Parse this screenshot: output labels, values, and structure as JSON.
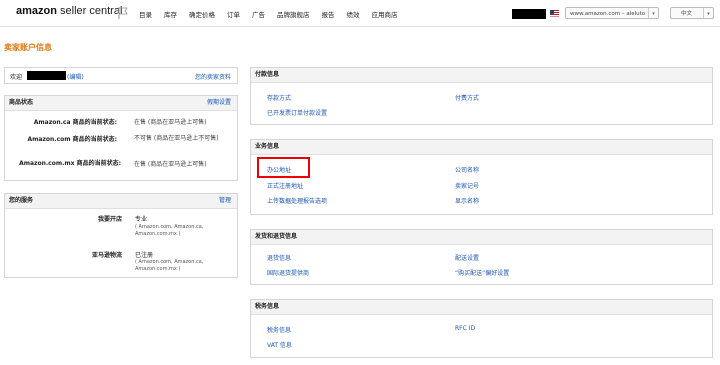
{
  "header": {
    "logo_brand": "amazon",
    "logo_product": " seller central",
    "nav": [
      "目录",
      "库存",
      "确定价格",
      "订单",
      "广告",
      "品牌旗舰店",
      "报告",
      "绩效",
      "应用商店"
    ],
    "marketplace_select": "www.amazon.com – aleluto",
    "language_select": "中文",
    "accent_color": "#e47911"
  },
  "page_title": "卖家账户信息",
  "welcome": {
    "prefix": "欢迎",
    "edit_link": "(编辑)",
    "seller_profile_link": "您的卖家资料"
  },
  "listing_status": {
    "title": "商品状态",
    "action": "假期设置",
    "rows": [
      {
        "label": "Amazon.ca 商品的当前状态:",
        "value": "在售 (商品在亚马逊上可售)"
      },
      {
        "label": "Amazon.com 商品的当前状态:",
        "value": "不可售 (商品在亚马逊上不可售)"
      },
      {
        "label": "Amazon.com.mx 商品的当前状态:",
        "value": "在售 (商品在亚马逊上可售)"
      }
    ]
  },
  "your_services": {
    "title": "您的服务",
    "action": "管理",
    "rows": [
      {
        "label": "我要开店",
        "value": "专业",
        "detail": "( Amazon.com, Amazon.ca, Amazon.com.mx )"
      },
      {
        "label": "亚马逊物流",
        "value": "已注册",
        "detail": "( Amazon.com, Amazon.ca, Amazon.com.mx )"
      }
    ]
  },
  "payment_info": {
    "title": "付款信息",
    "links": [
      "存款方式",
      "付费方式",
      "已开发票订单付款设置"
    ]
  },
  "business_info": {
    "title": "业务信息",
    "links": [
      "办公地址",
      "公司名称",
      "正式注册地址",
      "卖家记号",
      "上传数据处理报告选项",
      "显示名称"
    ]
  },
  "shipping_returns": {
    "title": "发货和退货信息",
    "links": [
      "退货信息",
      "配送设置",
      "国际退货提供商",
      "“购买配送”偏好设置"
    ]
  },
  "tax_info": {
    "title": "税务信息",
    "links": [
      "税务信息",
      "RFC ID",
      "VAT 信息"
    ]
  }
}
